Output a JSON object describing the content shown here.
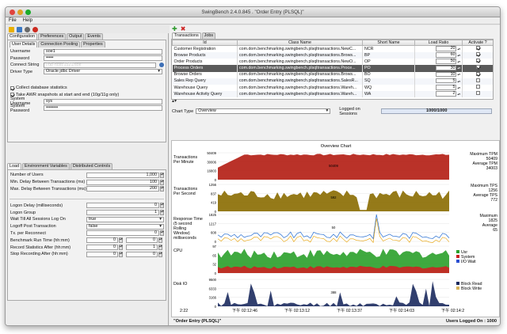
{
  "window": {
    "title": "SwingBench 2.4.0.845 . \"Order Entry (PLSQL)\""
  },
  "menu": [
    "File",
    "Help"
  ],
  "left": {
    "tabs": [
      "Configuration",
      "Preferences",
      "Output",
      "Events"
    ],
    "subtabs": [
      "User Details",
      "Connection Pooling",
      "Properties"
    ],
    "username_label": "Username",
    "username": "soe1",
    "password_label": "Password",
    "password": "•••••",
    "connect_label": "Connect String",
    "connect": "//db-host:1521/soe",
    "driver_label": "Driver Type",
    "driver": "Oracle jdbc Driver",
    "collect_label": "Collect database statistics",
    "awr_label": "Take AWR snapshots at start and end (10g/11g only)",
    "sysuser_label": "System Username",
    "sysuser": "sys",
    "syspass_label": "System Password",
    "syspass": "••••••••",
    "load_tabs": [
      "Load",
      "Environment Variables",
      "Distributed Controls"
    ],
    "load": [
      {
        "label": "Number of Users",
        "value": "1,000"
      },
      {
        "label": "Min. Delay Between Transactions (ms)",
        "value": "100"
      },
      {
        "label": "Max. Delay Between Transactions (ms)",
        "value": "200"
      }
    ],
    "logon_delay_label": "Logon Delay (milliseconds)",
    "logon_delay": "0",
    "logon_group_label": "Logon Group",
    "logon_group": "1",
    "wait_label": "Wait Till All Sessions Log On",
    "wait": "true",
    "logoff_label": "Logoff Post Transaction",
    "logoff": "false",
    "reconnect_label": "Tx. per Reconnect",
    "reconnect": "0",
    "runtime_label": "Benchmark Run Time (hh:mm)",
    "runtime_h": "0",
    "runtime_m": "0",
    "record_label": "Record Statistics After (hh:mm)",
    "record_h": "0",
    "record_m": "1",
    "stop_label": "Stop Recording After (hh:mm)",
    "stop_h": "0",
    "stop_m": "0"
  },
  "transactions": {
    "tabs": [
      "Transactions",
      "Jobs"
    ],
    "headers": [
      "Id",
      "Class Name",
      "Short Name",
      "Load Ratio",
      "Activate ?"
    ],
    "rows": [
      {
        "id": "Customer Registration",
        "cls": "com.dom.benchmarking.swingbench.plsqltransactions.NewC...",
        "short": "NCR",
        "ratio": "20",
        "on": true
      },
      {
        "id": "Browse Products",
        "cls": "com.dom.benchmarking.swingbench.plsqltransactions.Brows...",
        "short": "BP",
        "ratio": "60",
        "on": true
      },
      {
        "id": "Order Products",
        "cls": "com.dom.benchmarking.swingbench.plsqltransactions.NewO...",
        "short": "OP",
        "ratio": "50",
        "on": true
      },
      {
        "id": "Process Orders",
        "cls": "com.dom.benchmarking.swingbench.plsqltransactions.Proce...",
        "short": "PO",
        "ratio": "30",
        "on": true
      },
      {
        "id": "Browse Orders",
        "cls": "com.dom.benchmarking.swingbench.plsqltransactions.Brows...",
        "short": "BO",
        "ratio": "10",
        "on": true
      },
      {
        "id": "Sales Rep Query",
        "cls": "com.dom.benchmarking.swingbench.plsqltransactions.SalesR...",
        "short": "SQ",
        "ratio": "5",
        "on": false
      },
      {
        "id": "Warehouse Query",
        "cls": "com.dom.benchmarking.swingbench.plsqltransactions.Wareh...",
        "short": "WQ",
        "ratio": "5",
        "on": false
      },
      {
        "id": "Warehouse Activity Query",
        "cls": "com.dom.benchmarking.swingbench.plsqltransactions.Wareh...",
        "short": "WA",
        "ratio": "2",
        "on": false
      }
    ]
  },
  "charttype": {
    "label": "Chart Type",
    "value": "Overview",
    "sessions_label": "Logged on Sessions",
    "sessions": "1000/1000"
  },
  "chart_data": {
    "type": "area",
    "title": "Overview Chart",
    "x": [
      "2:22",
      "下午 02:12:46",
      "下午 02:13:12",
      "下午 02:13:37",
      "下午 02:14:03",
      "下午 02:14:2"
    ],
    "panels": [
      {
        "name": "Transactions Per Minute",
        "ticks": [
          "50409",
          "30006",
          "16803",
          "0"
        ],
        "mid": "50409",
        "stats": [
          "Maximum TPM",
          "50409",
          "Average TPM",
          "34003"
        ],
        "color": "#b31c12"
      },
      {
        "name": "Transactions Per Second",
        "ticks": [
          "1256",
          "837",
          "419",
          "0"
        ],
        "mid": "592",
        "stats": [
          "Maximum TPS",
          "1256",
          "Average TPS",
          "772"
        ],
        "color": "#8a6b00"
      },
      {
        "name": "Response Time (5 second Rolling Window) milliseconds",
        "ticks": [
          "1825",
          "1217",
          "608",
          "0"
        ],
        "mid": "50",
        "stats": [
          "Maximum",
          "1825",
          "Average",
          "65"
        ],
        "color": "#3a7bd5"
      },
      {
        "name": "CPU",
        "ticks": [
          "97",
          "65",
          "32",
          "0"
        ],
        "mid": "",
        "stats": [],
        "color": "#2aa02a"
      },
      {
        "name": "Disk IO",
        "ticks": [
          "9500",
          "6333",
          "3166",
          "0"
        ],
        "mid": "388",
        "stats": [],
        "color": "#1b2a5e"
      }
    ],
    "cpu_legend": [
      "Usr",
      "System",
      "I/O Wait"
    ],
    "io_legend": [
      "Block Read",
      "Block Write"
    ]
  },
  "status": {
    "left": "\"Order Entry (PLSQL)\"",
    "right": "Users Logged On : 1000"
  }
}
